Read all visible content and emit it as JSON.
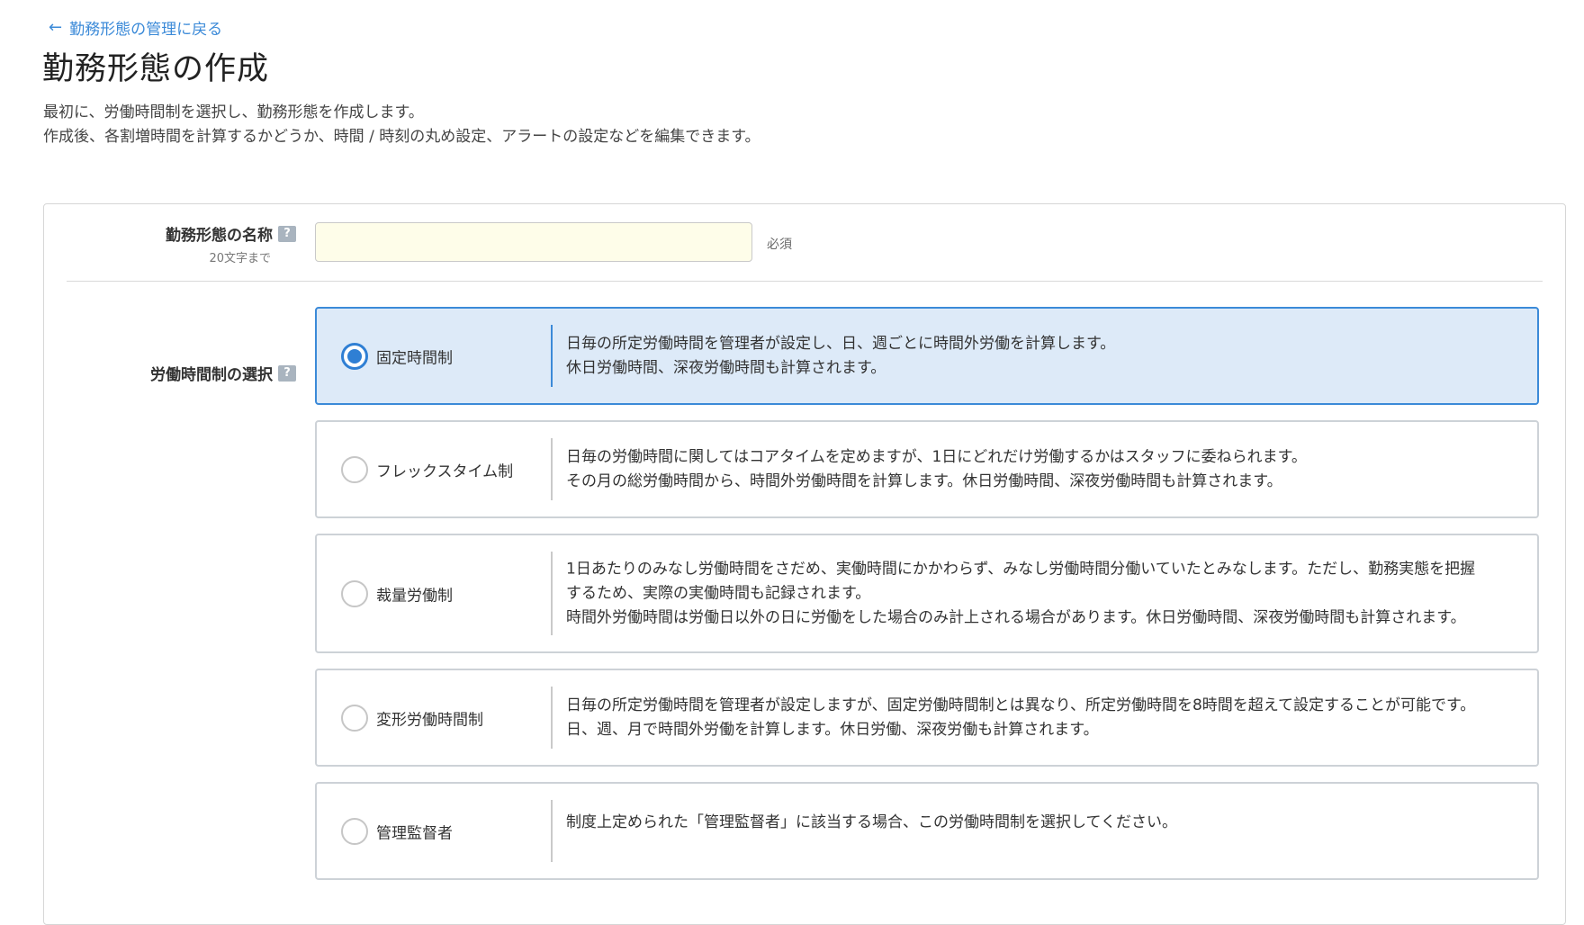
{
  "back_link": {
    "arrow": "←",
    "label": "勤務形態の管理に戻る"
  },
  "page": {
    "title": "勤務形態の作成",
    "intro": [
      "最初に、労働時間制を選択し、勤務形態を作成します。",
      "作成後、各割増時間を計算するかどうか、時間 / 時刻の丸め設定、アラートの設定などを編集できます。"
    ]
  },
  "name_field": {
    "label": "勤務形態の名称",
    "help": "?",
    "hint": "20文字まで",
    "value": "",
    "required": "必須"
  },
  "regime_field": {
    "label": "労働時間制の選択",
    "help": "?",
    "options": [
      {
        "label": "固定時間制",
        "selected": true,
        "desc": [
          "日毎の所定労働時間を管理者が設定し、日、週ごとに時間外労働を計算します。",
          "休日労働時間、深夜労働時間も計算されます。"
        ]
      },
      {
        "label": "フレックスタイム制",
        "selected": false,
        "desc": [
          "日毎の労働時間に関してはコアタイムを定めますが、1日にどれだけ労働するかはスタッフに委ねられます。",
          "その月の総労働時間から、時間外労働時間を計算します。休日労働時間、深夜労働時間も計算されます。"
        ]
      },
      {
        "label": "裁量労働制",
        "selected": false,
        "desc": [
          "1日あたりのみなし労働時間をさだめ、実働時間にかかわらず、みなし労働時間分働いていたとみなします。ただし、勤務実態を把握",
          "するため、実際の実働時間も記録されます。",
          "時間外労働時間は労働日以外の日に労働をした場合のみ計上される場合があります。休日労働時間、深夜労働時間も計算されます。"
        ]
      },
      {
        "label": "変形労働時間制",
        "selected": false,
        "desc": [
          "日毎の所定労働時間を管理者が設定しますが、固定労働時間制とは異なり、所定労働時間を8時間を超えて設定することが可能です。",
          "日、週、月で時間外労働を計算します。休日労働、深夜労働も計算されます。"
        ]
      },
      {
        "label": "管理監督者",
        "selected": false,
        "desc": [
          "制度上定められた「管理監督者」に該当する場合、この労働時間制を選択してください。"
        ]
      }
    ]
  },
  "colors": {
    "link": "#3b8ad8",
    "selected_bg": "#ddeaf8",
    "selected_border": "#3b8ad8",
    "input_bg": "#fefde9"
  }
}
